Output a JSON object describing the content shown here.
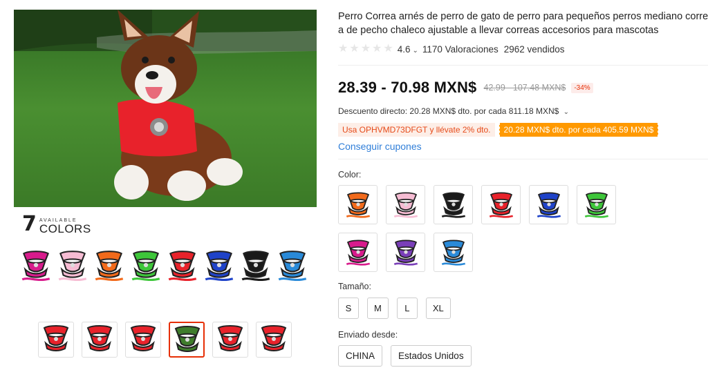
{
  "product": {
    "title": "Perro Correa arnés de perro de gato de perro para pequeños perros mediano corre a de pecho chaleco ajustable a llevar correas accesorios para mascotas",
    "title_line1": "Perro Correa arnés de perro de gato de perro para pequeños perros mediano corre",
    "title_line2": "a de pecho chaleco ajustable a llevar correas accesorios para mascotas",
    "rating": "4.6",
    "reviews": "1170 Valoraciones",
    "sold": "2962 vendidos"
  },
  "pricing": {
    "price": "28.39 - 70.98 MXN$",
    "original_price": "42.99 - 107.48 MXN$",
    "discount": "-34%",
    "direct_discount": "Descuento directo: 20.28 MXN$ dto. por cada 811.18 MXN$",
    "coupon_code": "Usa OPHVMD73DFGT y llévate 2% dto.",
    "coupon_deal": "20.28 MXN$ dto. por cada 405.59 MXN$",
    "get_coupons": "Conseguir cupones"
  },
  "promo": {
    "number": "7",
    "small": "AVAILABLE",
    "big": "COLORS",
    "harness_colors": [
      "#d81b8c",
      "#f6bcd3",
      "#f26a1b",
      "#3ec63a",
      "#e8222b",
      "#1f43c9",
      "#1a1a1a",
      "#2a8ad8"
    ]
  },
  "thumbnails": [
    {
      "active": false,
      "color": "#e8222b"
    },
    {
      "active": false,
      "color": "#e8222b"
    },
    {
      "active": false,
      "color": "#e8222b"
    },
    {
      "active": true,
      "color": "#3f7d2c"
    },
    {
      "active": false,
      "color": "#e8222b"
    },
    {
      "active": false,
      "color": "#e8222b"
    }
  ],
  "options": {
    "color_label": "Color:",
    "colors": [
      "#f26a1b",
      "#f6bcd3",
      "#1a1a1a",
      "#e8222b",
      "#1f43c9",
      "#3ec63a",
      "#d81b8c",
      "#7a3fb8",
      "#2a8ad8"
    ],
    "size_label": "Tamaño:",
    "sizes": [
      "S",
      "M",
      "L",
      "XL"
    ],
    "ship_label": "Enviado desde:",
    "ships_from": [
      "CHINA",
      "Estados Unidos"
    ]
  }
}
